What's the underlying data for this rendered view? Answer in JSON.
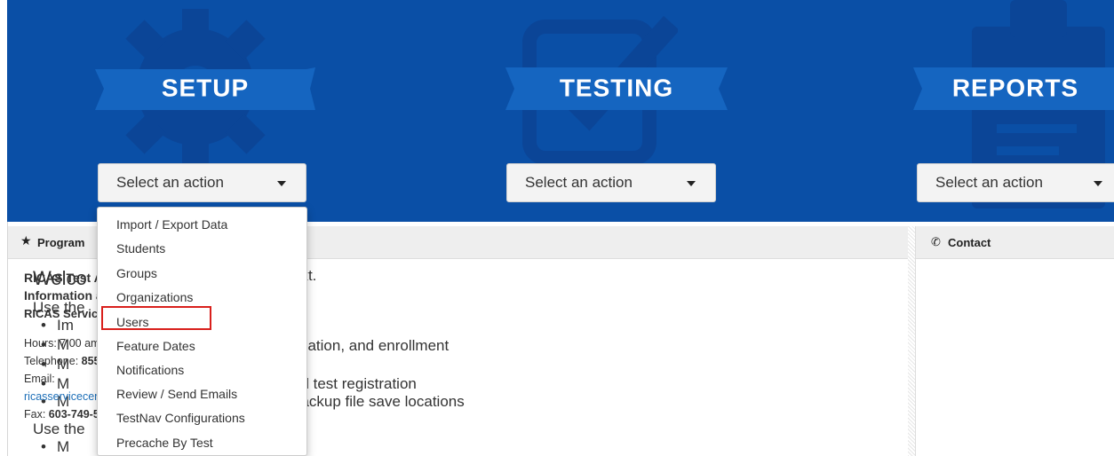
{
  "colors": {
    "banner": "#0a4fa6",
    "highlight": "#d9201c",
    "link": "#1d6fb8"
  },
  "sections": [
    {
      "title": "SETUP",
      "icon": "gear-icon",
      "select_label": "Select an action"
    },
    {
      "title": "TESTING",
      "icon": "checkbox-icon",
      "select_label": "Select an action"
    },
    {
      "title": "REPORTS",
      "icon": "clipboard-icon",
      "select_label": "Select an action"
    }
  ],
  "setup_menu": {
    "items": [
      "Import / Export Data",
      "Students",
      "Groups",
      "Organizations",
      "Users",
      "Feature Dates",
      "Notifications",
      "Review / Send Emails",
      "TestNav Configurations",
      "Precache By Test"
    ],
    "highlighted": "Users"
  },
  "program_panel": {
    "header": "Program",
    "welcome": "Welco",
    "welcome_tail": "ext.",
    "lines": [
      "Use the",
      "Im",
      "M",
      "pation, and enrollment",
      "M",
      "M",
      "nd test registration",
      "M",
      "backup file save locations",
      "Use the",
      "M"
    ]
  },
  "contact_panel": {
    "header": "Contact",
    "title_line1": "RICAS Test Administratio",
    "title_line2": "Information and Online S",
    "center": "RICAS Service Center",
    "hours": "Hours: 7:00 am-5:00 pm, Mon",
    "telephone_label": "Telephone: ",
    "telephone": "855-222-8936",
    "email_label": "Email:",
    "email": "ricasservicecenter@measured",
    "fax_label": "Fax: ",
    "fax": "603-749-5108"
  }
}
